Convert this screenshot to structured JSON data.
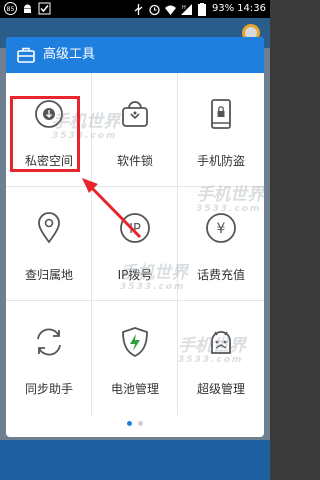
{
  "status_bar": {
    "battery_percent": "93%",
    "time": "14:36",
    "icons": [
      "notification-count-icon",
      "android-icon",
      "check-icon",
      "usb-icon",
      "alarm-icon",
      "wifi-icon",
      "signal-icon",
      "battery-icon"
    ],
    "notification_count": "85"
  },
  "panel": {
    "title": "高级工具",
    "header_icon": "toolbox-icon",
    "accent_color": "#1f7fde",
    "tools": [
      {
        "label": "私密空间",
        "icon": "download-circle-icon"
      },
      {
        "label": "软件锁",
        "icon": "lock-box-icon"
      },
      {
        "label": "手机防盗",
        "icon": "phone-lock-icon"
      },
      {
        "label": "查归属地",
        "icon": "location-pin-icon"
      },
      {
        "label": "IP拨号",
        "icon": "ip-dial-icon"
      },
      {
        "label": "话费充值",
        "icon": "yen-coin-icon"
      },
      {
        "label": "同步助手",
        "icon": "sync-icon"
      },
      {
        "label": "电池管理",
        "icon": "battery-shield-icon"
      },
      {
        "label": "超级管理",
        "icon": "android-admin-icon"
      }
    ],
    "page_indicator": {
      "pages": 2,
      "current": 1
    }
  },
  "annotation": {
    "highlight_color": "#e8242c",
    "highlighted_tool": "私密空间"
  },
  "watermark": {
    "brand": "手机世界",
    "domain": "3533.com"
  }
}
